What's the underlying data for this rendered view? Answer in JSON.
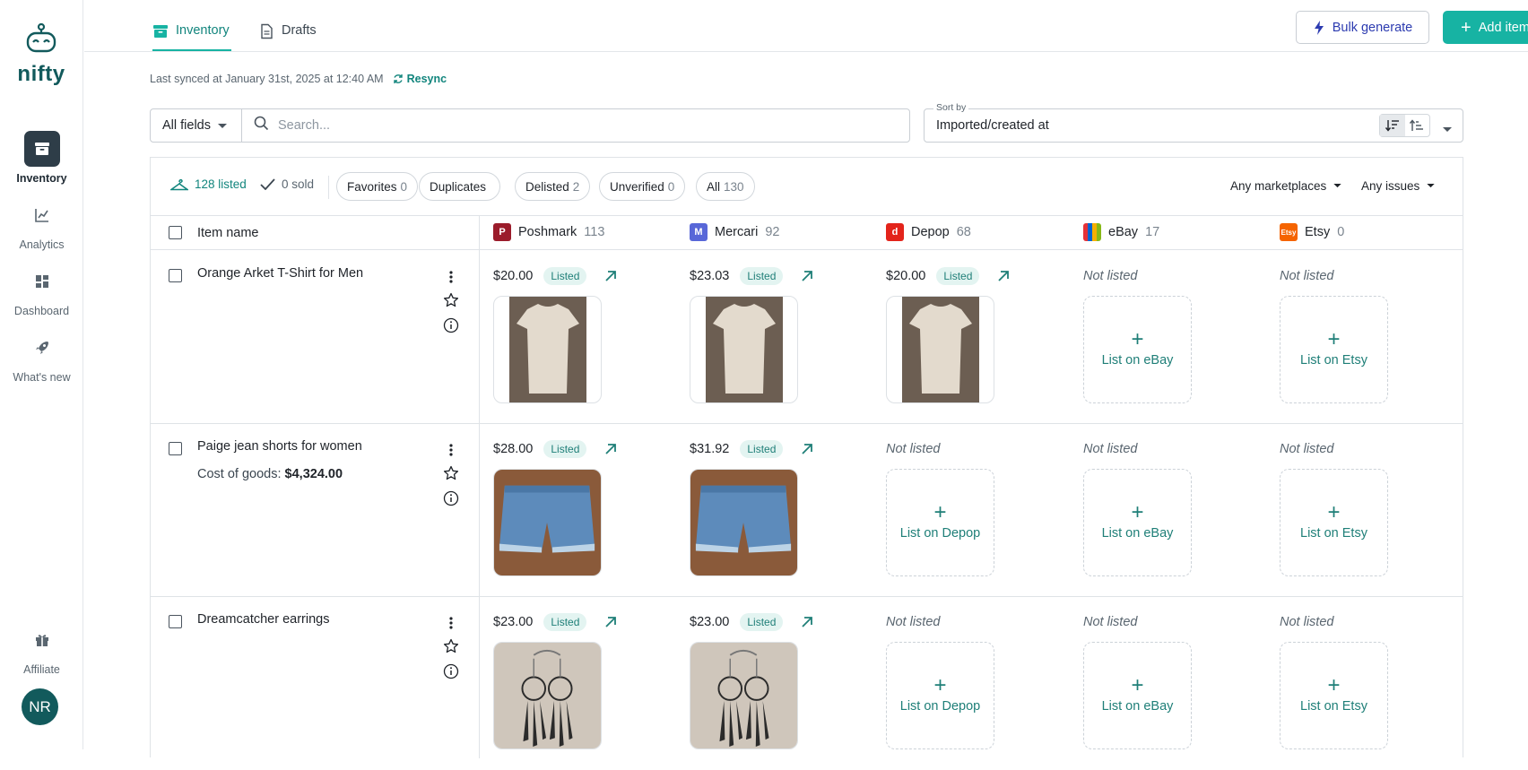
{
  "brand": {
    "name": "nifty"
  },
  "nav": {
    "inventory": "Inventory",
    "analytics": "Analytics",
    "dashboard": "Dashboard",
    "whats_new": "What's new",
    "affiliate": "Affiliate",
    "avatar_initials": "NR"
  },
  "tabs": {
    "inventory": "Inventory",
    "drafts": "Drafts"
  },
  "actions": {
    "bulk_generate": "Bulk generate",
    "add_item": "Add item"
  },
  "sync": {
    "text": "Last synced at January 31st, 2025 at 12:40 AM",
    "resync": "Resync"
  },
  "search": {
    "field": "All fields",
    "placeholder": "Search..."
  },
  "sort": {
    "legend": "Sort by",
    "value": "Imported/created at"
  },
  "filters": {
    "listed": "128 listed",
    "sold": "0 sold",
    "chips": [
      {
        "label": "Favorites",
        "count": "0"
      },
      {
        "label": "Duplicates",
        "count": ""
      },
      {
        "label": "Delisted",
        "count": "2"
      },
      {
        "label": "Unverified",
        "count": "0"
      },
      {
        "label": "All",
        "count": "130"
      }
    ],
    "marketplaces": "Any marketplaces",
    "issues": "Any issues"
  },
  "table": {
    "item_name_header": "Item name",
    "marketplaces": [
      {
        "name": "Poshmark",
        "count": "113",
        "color": "#9b1c2b"
      },
      {
        "name": "Mercari",
        "count": "92",
        "color": "#5867d8"
      },
      {
        "name": "Depop",
        "count": "68",
        "color": "#e3241b"
      },
      {
        "name": "eBay",
        "count": "17",
        "color": "#e53238"
      },
      {
        "name": "Etsy",
        "count": "0",
        "color": "#f56400"
      }
    ],
    "rows": [
      {
        "name": "Orange Arket T-Shirt for Men",
        "cog_label": "",
        "cog_value": "",
        "cells": [
          {
            "price": "$20.00",
            "status": "Listed"
          },
          {
            "price": "$23.03",
            "status": "Listed"
          },
          {
            "price": "$20.00",
            "status": "Listed"
          },
          {
            "not_listed": "Not listed",
            "cta": "List on eBay"
          },
          {
            "not_listed": "Not listed",
            "cta": "List on Etsy"
          }
        ]
      },
      {
        "name": "Paige jean shorts for women",
        "cog_label": "Cost of goods:",
        "cog_value": "$4,324.00",
        "cells": [
          {
            "price": "$28.00",
            "status": "Listed"
          },
          {
            "price": "$31.92",
            "status": "Listed"
          },
          {
            "not_listed": "Not listed",
            "cta": "List on Depop"
          },
          {
            "not_listed": "Not listed",
            "cta": "List on eBay"
          },
          {
            "not_listed": "Not listed",
            "cta": "List on Etsy"
          }
        ]
      },
      {
        "name": "Dreamcatcher earrings",
        "cog_label": "",
        "cog_value": "",
        "cells": [
          {
            "price": "$23.00",
            "status": "Listed"
          },
          {
            "price": "$23.00",
            "status": "Listed"
          },
          {
            "not_listed": "Not listed",
            "cta": "List on Depop"
          },
          {
            "not_listed": "Not listed",
            "cta": "List on eBay"
          },
          {
            "not_listed": "Not listed",
            "cta": "List on Etsy"
          }
        ]
      }
    ]
  }
}
